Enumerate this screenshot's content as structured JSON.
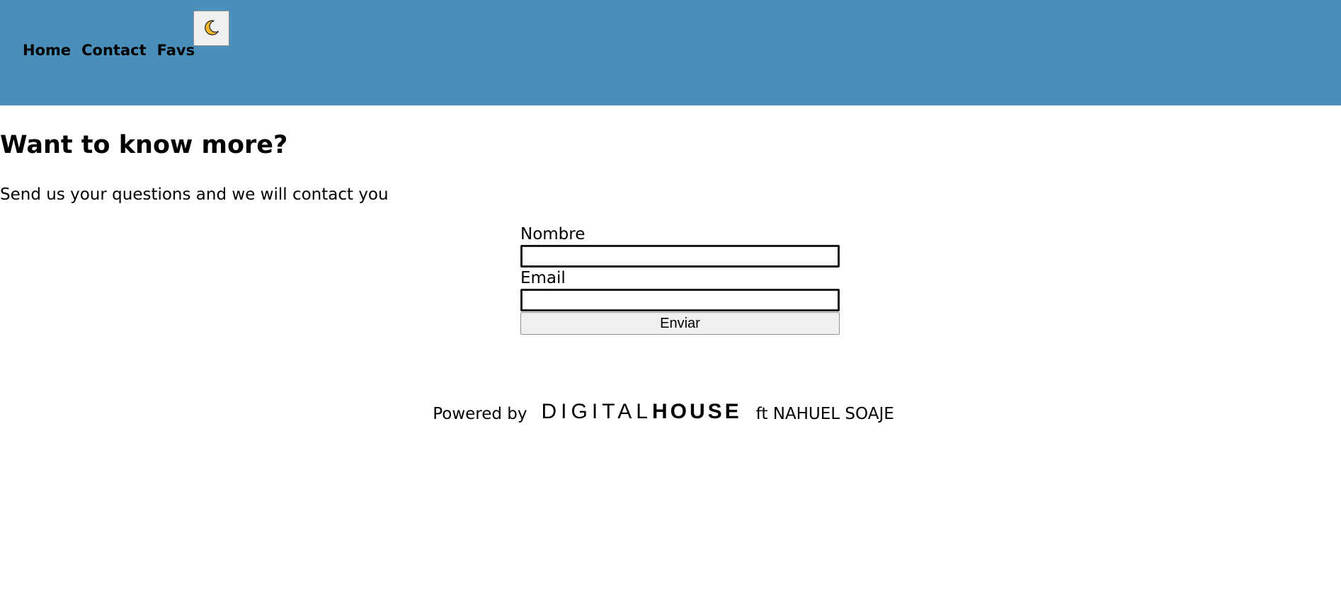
{
  "colors": {
    "header_bg": "#4a8fba",
    "moon": "#f5b82a"
  },
  "nav": {
    "items": [
      {
        "label": "Home"
      },
      {
        "label": "Contact"
      },
      {
        "label": "Favs"
      }
    ],
    "theme_toggle_icon": "moon-icon"
  },
  "main": {
    "title": "Want to know more?",
    "subtitle": "Send us your questions and we will contact you"
  },
  "form": {
    "name_label": "Nombre",
    "name_value": "",
    "email_label": "Email",
    "email_value": "",
    "submit_label": "Enviar"
  },
  "footer": {
    "powered_by": "Powered by",
    "logo_light": "DIGITAL",
    "logo_bold": "HOUSE",
    "credit": "ft NAHUEL SOAJE"
  }
}
